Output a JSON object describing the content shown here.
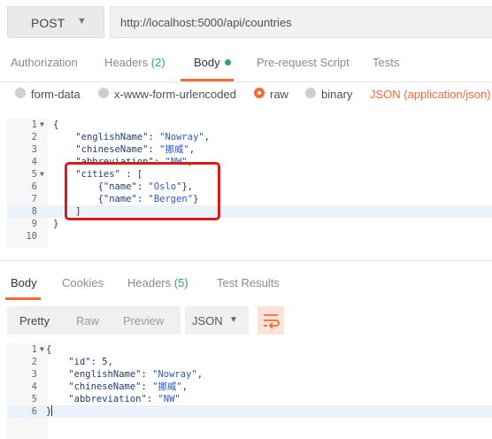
{
  "request": {
    "method": "POST",
    "url": "http://localhost:5000/api/countries"
  },
  "request_tabs": {
    "authorization": "Authorization",
    "headers": "Headers",
    "headers_count": "(2)",
    "body": "Body",
    "pre_request": "Pre-request Script",
    "tests": "Tests"
  },
  "body_types": {
    "form_data": "form-data",
    "urlencoded": "x-www-form-urlencoded",
    "raw": "raw",
    "binary": "binary",
    "content_type": "JSON (application/json)"
  },
  "request_body": {
    "line_numbers": [
      "1",
      "2",
      "3",
      "4",
      "5",
      "6",
      "7",
      "8",
      "9",
      "10"
    ],
    "l1": "{",
    "l2_key": "\"englishName\"",
    "l2_val": "\"Nowray\"",
    "l3_key": "\"chineseName\"",
    "l3_val": "\"挪威\"",
    "l4_key": "\"abbreviation\"",
    "l4_val": "\"NW\"",
    "l5_key": "\"cities\"",
    "l6_val": "\"Oslo\"",
    "l7_val": "\"Bergen\"",
    "l8": "]",
    "l9": "}",
    "name_key": "\"name\""
  },
  "response_tabs": {
    "body": "Body",
    "cookies": "Cookies",
    "headers": "Headers",
    "headers_count": "(5)",
    "test_results": "Test Results"
  },
  "response_toolbar": {
    "pretty": "Pretty",
    "raw": "Raw",
    "preview": "Preview",
    "format": "JSON",
    "wrap_icon": "wrap-lines-icon"
  },
  "response_body": {
    "line_numbers": [
      "1",
      "2",
      "3",
      "4",
      "5",
      "6"
    ],
    "l1": "{",
    "l2_key": "\"id\"",
    "l2_val": "5",
    "l3_key": "\"englishName\"",
    "l3_val": "\"Nowray\"",
    "l4_key": "\"chineseName\"",
    "l4_val": "\"挪威\"",
    "l5_key": "\"abbreviation\"",
    "l5_val": "\"NW\"",
    "l6": "}"
  },
  "colors": {
    "accent": "#f26b3a",
    "highlight_box": "#d81b1b",
    "active_line": "#eaf3fb"
  }
}
